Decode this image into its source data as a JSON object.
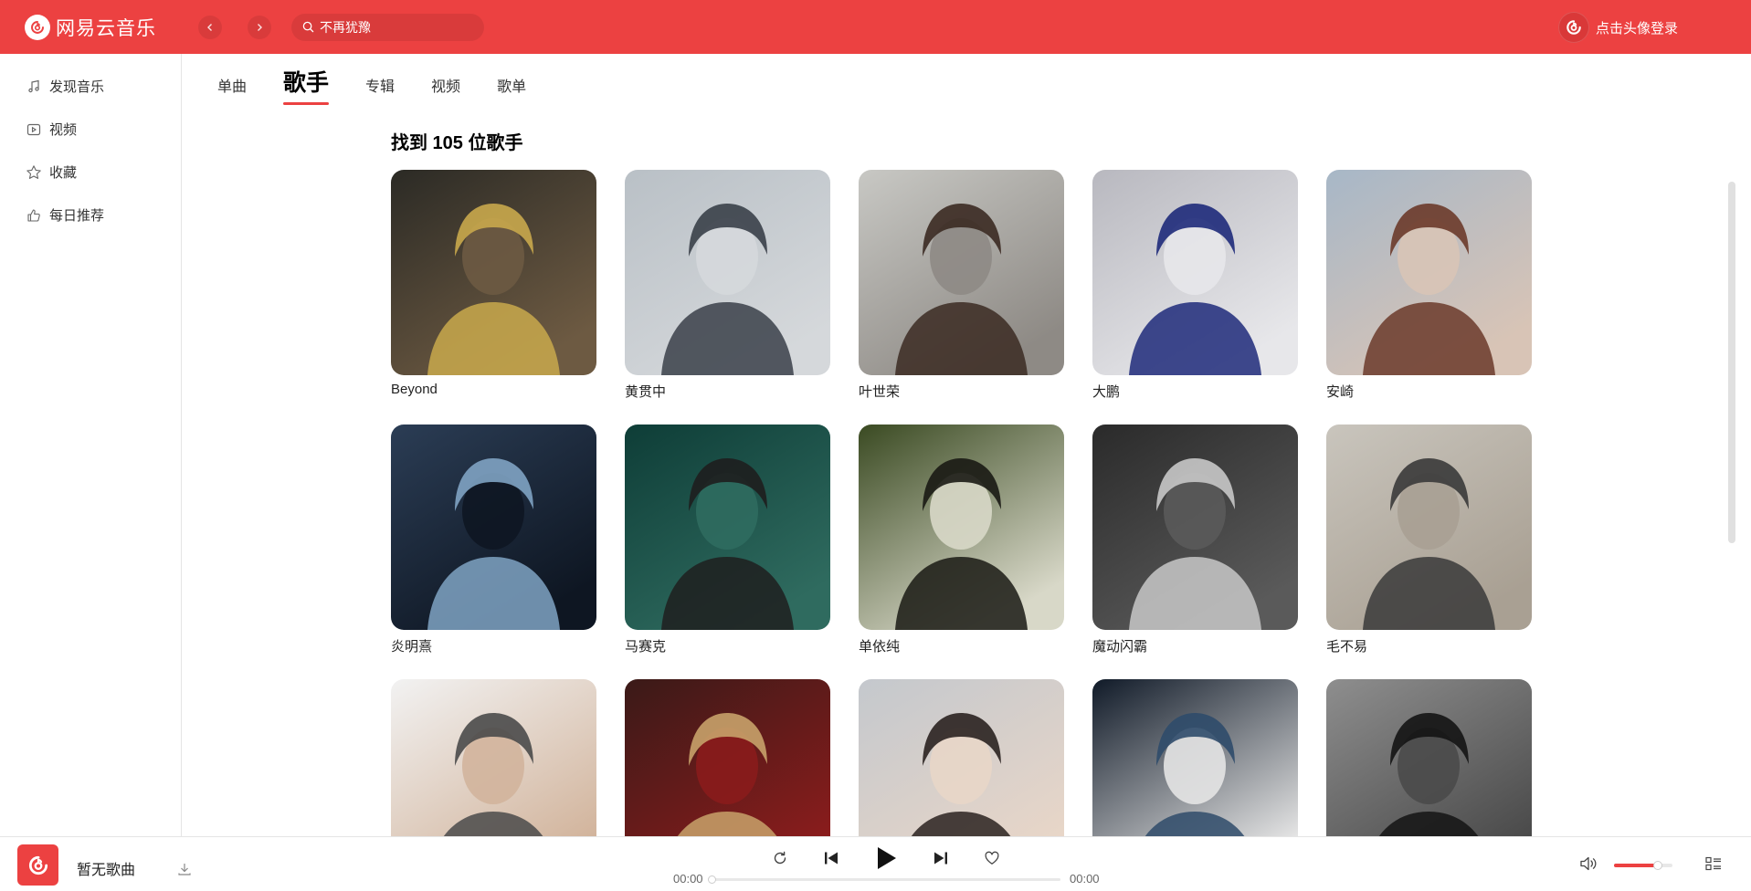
{
  "app": {
    "title": "网易云音乐",
    "brand_color": "#ec4141"
  },
  "search": {
    "value": "不再犹豫"
  },
  "user": {
    "login_label": "点击头像登录"
  },
  "sidebar": {
    "items": [
      {
        "label": "发现音乐",
        "icon": "music-note-icon"
      },
      {
        "label": "视频",
        "icon": "video-icon"
      },
      {
        "label": "收藏",
        "icon": "star-icon"
      },
      {
        "label": "每日推荐",
        "icon": "thumbs-up-icon"
      }
    ]
  },
  "tabs": [
    {
      "label": "单曲",
      "active": false
    },
    {
      "label": "歌手",
      "active": true
    },
    {
      "label": "专辑",
      "active": false
    },
    {
      "label": "视频",
      "active": false
    },
    {
      "label": "歌单",
      "active": false
    }
  ],
  "results": {
    "title": "找到 105 位歌手",
    "artists": [
      {
        "name": "Beyond",
        "tone": [
          "#2b2a25",
          "#c9a94c",
          "#6d5a42"
        ]
      },
      {
        "name": "黄贯中",
        "tone": [
          "#b9c0c6",
          "#3a4049",
          "#d5d8db"
        ]
      },
      {
        "name": "叶世荣",
        "tone": [
          "#c8c8c4",
          "#3b2a22",
          "#8e8a85"
        ]
      },
      {
        "name": "大鹏",
        "tone": [
          "#b8b8bf",
          "#1e2a7a",
          "#e7e7ea"
        ]
      },
      {
        "name": "安崎",
        "tone": [
          "#a7b7c7",
          "#6b3a2a",
          "#d8c4b6"
        ]
      },
      {
        "name": "炎明熹",
        "tone": [
          "#2b3d55",
          "#7fa3c3",
          "#0e1622"
        ]
      },
      {
        "name": "马赛克",
        "tone": [
          "#0e3d37",
          "#1e1e1e",
          "#2f6b5f"
        ]
      },
      {
        "name": "单依纯",
        "tone": [
          "#3a4a22",
          "#1a1a14",
          "#d8d8c8"
        ]
      },
      {
        "name": "魔动闪霸",
        "tone": [
          "#2a2a2a",
          "#c8c8c8",
          "#5a5a5a"
        ]
      },
      {
        "name": "毛不易",
        "tone": [
          "#c9c5bd",
          "#3a3a3a",
          "#a9a093"
        ]
      },
      {
        "name": "",
        "tone": [
          "#f2f2f2",
          "#4a4a4a",
          "#d2b49c"
        ]
      },
      {
        "name": "",
        "tone": [
          "#3a1a18",
          "#c8a26a",
          "#8a1c1c"
        ]
      },
      {
        "name": "",
        "tone": [
          "#c4c8cd",
          "#2a2220",
          "#e8d6c8"
        ]
      },
      {
        "name": "",
        "tone": [
          "#101a28",
          "#2f4b6a",
          "#e4e4e4"
        ]
      },
      {
        "name": "",
        "tone": [
          "#8e8e8e",
          "#141414",
          "#4a4a4a"
        ]
      }
    ]
  },
  "player": {
    "song_title": "暂无歌曲",
    "time_current": "00:00",
    "time_total": "00:00",
    "progress_fraction": 0,
    "volume_fraction": 0.75
  }
}
